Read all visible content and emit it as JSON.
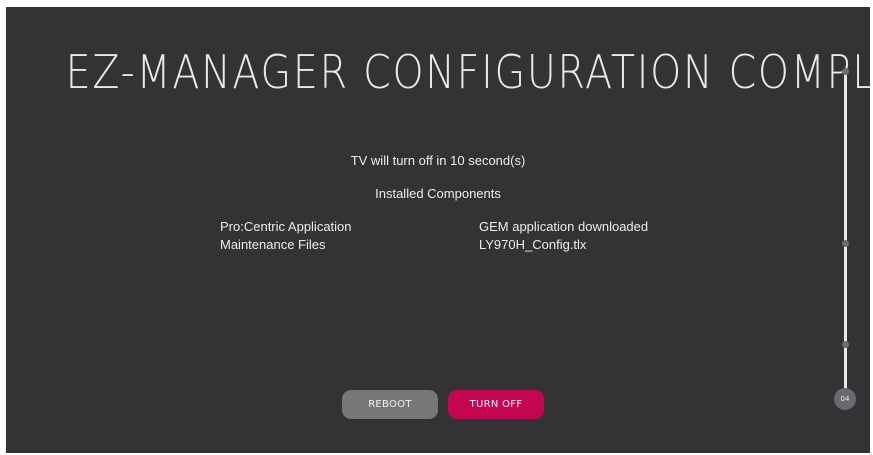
{
  "page": {
    "title": "EZ-MANAGER CONFIGURATION COMPLETE",
    "countdown": "TV will turn off in 10 second(s)",
    "installed_heading": "Installed Components"
  },
  "components": [
    {
      "name": "Pro:Centric Application",
      "value": "GEM application downloaded"
    },
    {
      "name": "Maintenance Files",
      "value": "LY970H_Config.tlx"
    }
  ],
  "buttons": {
    "reboot_label": "REBOOT",
    "turn_off_label": "TURN OFF"
  },
  "progress": {
    "step_label": "04"
  },
  "colors": {
    "background": "#333234",
    "reboot_button": "#777679",
    "turn_off_button": "#c3064f",
    "text": "#e6e6e6"
  }
}
